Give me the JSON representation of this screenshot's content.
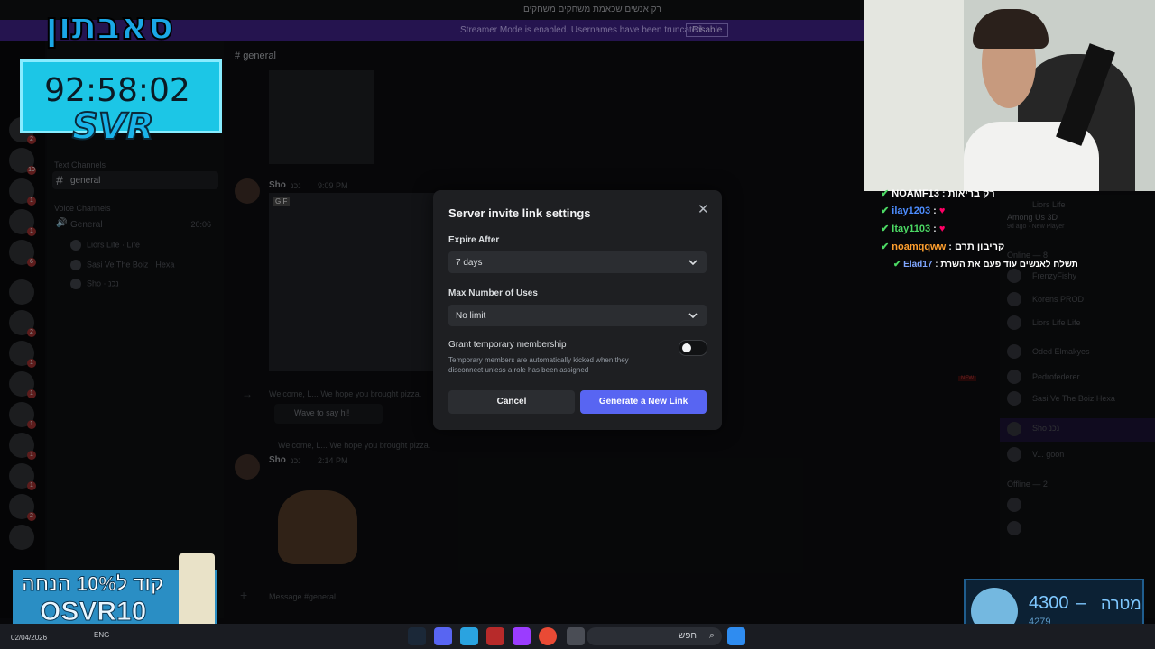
{
  "window": {
    "title": "רק אנשים שכאמת משחקים משחקים"
  },
  "banner": {
    "message": "Streamer Mode is enabled. Usernames have been truncated.",
    "disable_label": "Disable"
  },
  "channels": {
    "text_category": "Text Channels",
    "voice_category": "Voice Channels",
    "active_channel": "general",
    "voice_channel": "General",
    "voice_time": "20:06",
    "voice_users": [
      "Liors Life",
      "Sasi Ve The Boiz",
      "Sho"
    ],
    "voice_user_tags": [
      "Life",
      "Hexa",
      "נכנ"
    ]
  },
  "chat": {
    "channel": "general",
    "messages": [
      {
        "author": "Sho",
        "tag": "נכנ",
        "time": "9:09 PM",
        "gif_label": "GIF"
      },
      {
        "welcome": "Welcome, L... We hope you brought pizza.",
        "sticker_label": "Wave to say hi!"
      },
      {
        "reply_preview": "Welcome, L... We hope you brought pizza.",
        "author": "Sho",
        "tag": "נכנ",
        "time": "2:14 PM"
      }
    ],
    "composer_placeholder": "Message #general",
    "new_badge": "NEW"
  },
  "modal": {
    "title": "Server invite link settings",
    "close_label": "✕",
    "expire_label": "Expire After",
    "expire_value": "7 days",
    "max_uses_label": "Max Number of Uses",
    "max_uses_value": "No limit",
    "grant_label": "Grant temporary membership",
    "grant_desc": "Temporary members are automatically kicked when they disconnect unless a role has been assigned",
    "grant_enabled": false,
    "cancel_label": "Cancel",
    "generate_label": "Generate a New Link"
  },
  "members": {
    "activity_name": "Liors Life",
    "activity_game": "Among Us 3D",
    "activity_meta": "9d ago · New Player",
    "online_header": "Online — 8",
    "online": [
      {
        "name": "FrenzyFishy",
        "tag": ""
      },
      {
        "name": "Korens",
        "tag": "PROD"
      },
      {
        "name": "Liors Life",
        "tag": "Life"
      },
      {
        "name": "Oded Elmakyes",
        "tag": ""
      },
      {
        "name": "Pedrofederer",
        "tag": ""
      },
      {
        "name": "Sasi Ve The Boiz",
        "tag": "Hexa"
      },
      {
        "name": "Sho",
        "tag": "נכנ"
      },
      {
        "name": "V...",
        "tag": "goon"
      }
    ],
    "offline_header": "Offline — 2"
  },
  "overlay": {
    "brand": "סאבתון",
    "timer": "92:58:02",
    "svr": "SVR",
    "twitch_chat": [
      {
        "user": "NOAMF13",
        "text": "רק בריאות",
        "color": "#ffffff"
      },
      {
        "user": "ilay1203",
        "text": "",
        "color": "#4d8dff"
      },
      {
        "user": "Itay1103",
        "text": "",
        "color": "#4cd964"
      },
      {
        "user": "noamqqww",
        "text": "קריבון תרם",
        "color": "#ff9f2e"
      },
      {
        "user": "Elad17",
        "text": "תשלח לאנשים עוד פעם את השרת",
        "color": "#7fa6ff"
      }
    ],
    "promo_line1": "קוד ל10% הנחה",
    "promo_line2": "OSVR10",
    "goal_value": "4300",
    "goal_current": "4279",
    "goal_label": "מטרה"
  },
  "taskbar": {
    "date": "02/04/2026",
    "lang": "ENG",
    "search": "חפש"
  },
  "colors": {
    "accent": "#5865f2",
    "banner": "#3a1f7a",
    "modal_bg": "#1e1f22"
  }
}
